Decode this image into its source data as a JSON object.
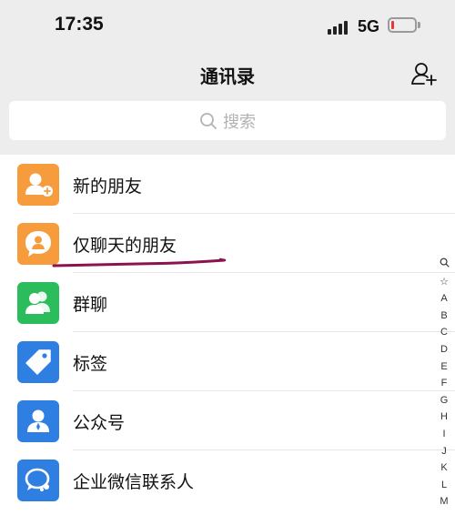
{
  "status_bar": {
    "time": "17:35",
    "network": "5G",
    "battery_level": 0.12,
    "battery_color": "#e53935"
  },
  "nav": {
    "title": "通讯录",
    "add_contact_icon": "add-contact-icon"
  },
  "search": {
    "placeholder": "搜索",
    "icon": "search-icon"
  },
  "list": {
    "items": [
      {
        "label": "新的朋友",
        "icon": "add-friend-icon",
        "color": "#f79c3c"
      },
      {
        "label": "仅聊天的朋友",
        "icon": "chat-only-friend-icon",
        "color": "#f79c3c"
      },
      {
        "label": "群聊",
        "icon": "group-chat-icon",
        "color": "#2bbd5c"
      },
      {
        "label": "标签",
        "icon": "tag-icon",
        "color": "#2f7fe3"
      },
      {
        "label": "公众号",
        "icon": "official-account-icon",
        "color": "#2f7fe3"
      },
      {
        "label": "企业微信联系人",
        "icon": "wecom-contacts-icon",
        "color": "#2f7fe3"
      }
    ],
    "annotation_color": "#8b1450"
  },
  "alpha_index": [
    "🔍",
    "☆",
    "A",
    "B",
    "C",
    "D",
    "E",
    "F",
    "G",
    "H",
    "I",
    "J",
    "K",
    "L",
    "M"
  ]
}
